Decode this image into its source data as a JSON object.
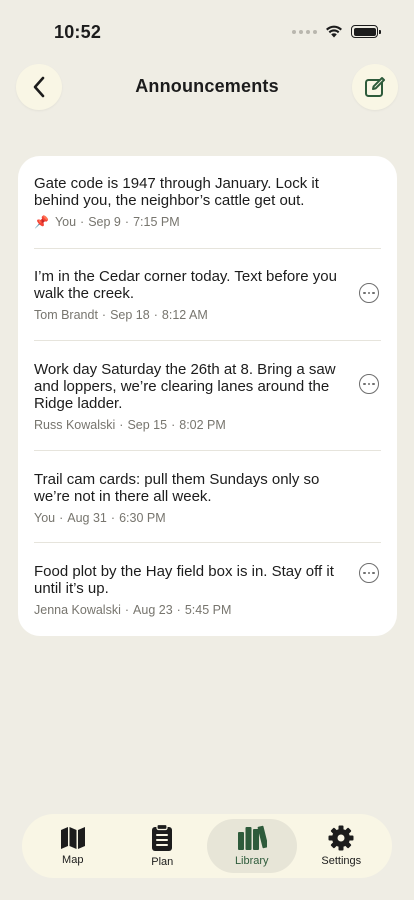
{
  "status_bar": {
    "time": "10:52"
  },
  "header": {
    "title": "Announcements",
    "back_icon": "chevron-left-icon",
    "compose_icon": "compose-icon"
  },
  "announcements": [
    {
      "text": "Gate code is 1947 through January. Lock it behind you, the neighbor’s cattle get out.",
      "author": "You",
      "date": "Sep 9",
      "time": "7:15 PM",
      "pinned": true,
      "has_more": false
    },
    {
      "text": "I’m in the Cedar corner today. Text before you walk the creek.",
      "author": "Tom Brandt",
      "date": "Sep 18",
      "time": "8:12 AM",
      "pinned": false,
      "has_more": true
    },
    {
      "text": "Work day Saturday the 26th at 8. Bring a saw and loppers, we’re clearing lanes around the Ridge ladder.",
      "author": "Russ Kowalski",
      "date": "Sep 15",
      "time": "8:02 PM",
      "pinned": false,
      "has_more": true
    },
    {
      "text": "Trail cam cards: pull them Sundays only so we’re not in there all week.",
      "author": "You",
      "date": "Aug 31",
      "time": "6:30 PM",
      "pinned": false,
      "has_more": false
    },
    {
      "text": "Food plot by the Hay field box is in. Stay off it until it’s up.",
      "author": "Jenna Kowalski",
      "date": "Aug 23",
      "time": "5:45 PM",
      "pinned": false,
      "has_more": true
    }
  ],
  "tabs": [
    {
      "label": "Map",
      "icon": "map-icon",
      "active": false
    },
    {
      "label": "Plan",
      "icon": "clipboard-icon",
      "active": false
    },
    {
      "label": "Library",
      "icon": "books-icon",
      "active": true
    },
    {
      "label": "Settings",
      "icon": "gear-icon",
      "active": false
    }
  ],
  "colors": {
    "background": "#efede4",
    "accent": "#2e5b3b",
    "pin": "#d9683e"
  }
}
